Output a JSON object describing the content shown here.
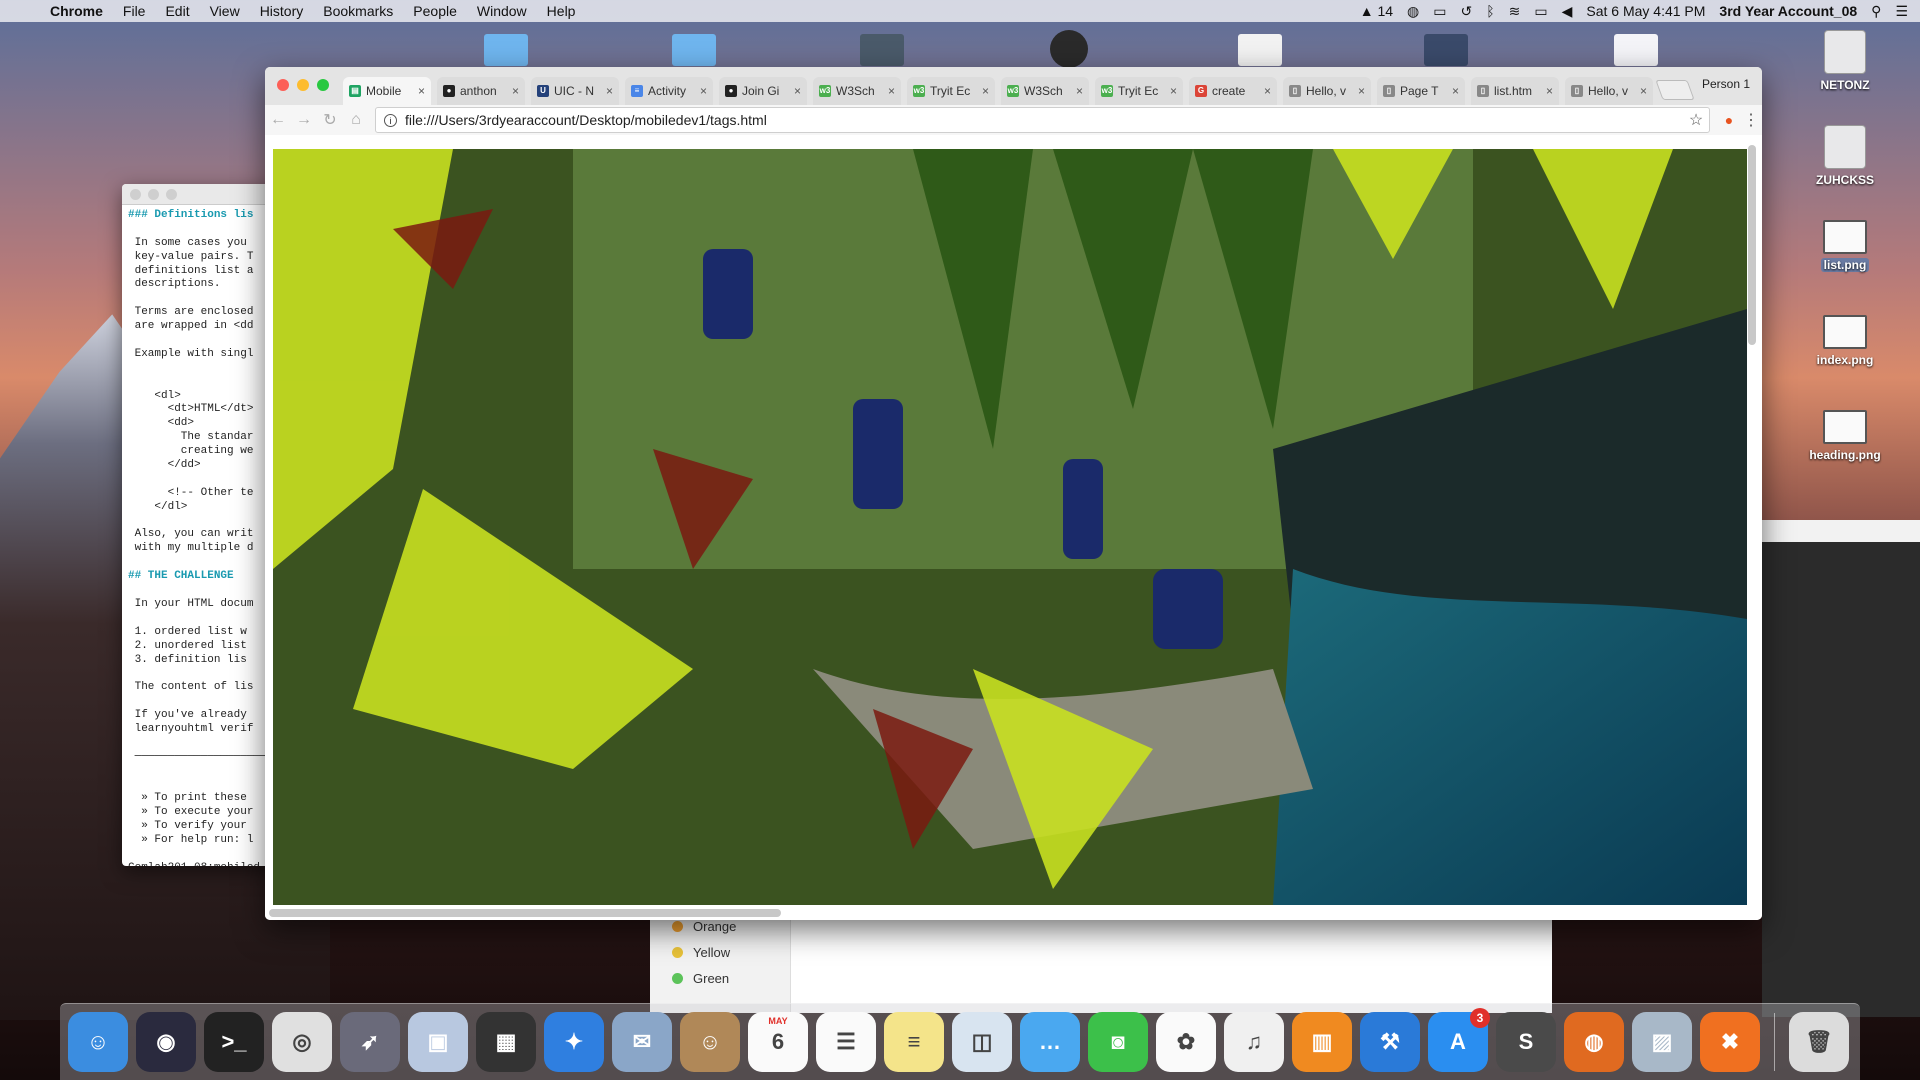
{
  "menubar": {
    "app": "Chrome",
    "items": [
      "File",
      "Edit",
      "View",
      "History",
      "Bookmarks",
      "People",
      "Window",
      "Help"
    ],
    "adobe_count": "14",
    "datetime": "Sat 6 May  4:41 PM",
    "account": "3rd Year Account_08"
  },
  "desktop_icons": [
    {
      "label": "NETONZ",
      "kind": "drive"
    },
    {
      "label": "ZUHCKSS",
      "kind": "drive"
    },
    {
      "label": "list.png",
      "kind": "png",
      "selected": true
    },
    {
      "label": "index.png",
      "kind": "png"
    },
    {
      "label": "heading.png",
      "kind": "png"
    }
  ],
  "terminal": {
    "lines": [
      "### Definitions lis",
      "",
      " In some cases you",
      " key-value pairs. T",
      " definitions list a",
      " descriptions.",
      "",
      " Terms are enclosed",
      " are wrapped in <dd",
      "",
      " Example with singl",
      "",
      "",
      "    <dl>",
      "      <dt>HTML</dt>",
      "      <dd>",
      "        The standar",
      "        creating we",
      "      </dd>",
      "",
      "      <!-- Other te",
      "    </dl>",
      "",
      " Also, you can writ",
      " with my multiple d",
      "",
      "## THE CHALLENGE",
      "",
      " In your HTML docum",
      "",
      " 1. ordered list w",
      " 2. unordered list",
      " 3. definition lis",
      "",
      " The content of lis",
      "",
      " If you've already",
      " learnyouhtml verif",
      "",
      " ─────────────────────",
      "",
      "",
      "  » To print these",
      "  » To execute your",
      "  » To verify your",
      "  » For help run: l",
      "",
      "Comlab201-08:mobiled"
    ]
  },
  "finder_list": [
    {
      "label": "Orange",
      "color": "#f0a030"
    },
    {
      "label": "Yellow",
      "color": "#e8c23a"
    },
    {
      "label": "Green",
      "color": "#5cc35a"
    }
  ],
  "browser": {
    "tabs": [
      {
        "title": "Mobile",
        "fav_color": "#1fa463",
        "fav": "▤",
        "active": true
      },
      {
        "title": "anthon",
        "fav_color": "#222",
        "fav": "●"
      },
      {
        "title": "UIC - N",
        "fav_color": "#24417a",
        "fav": "U"
      },
      {
        "title": "Activity",
        "fav_color": "#4a86e8",
        "fav": "≡"
      },
      {
        "title": "Join Gi",
        "fav_color": "#222",
        "fav": "●"
      },
      {
        "title": "W3Sch",
        "fav_color": "#4caf50",
        "fav": "w3"
      },
      {
        "title": "Tryit Ec",
        "fav_color": "#4caf50",
        "fav": "w3"
      },
      {
        "title": "W3Sch",
        "fav_color": "#4caf50",
        "fav": "w3"
      },
      {
        "title": "Tryit Ec",
        "fav_color": "#4caf50",
        "fav": "w3"
      },
      {
        "title": "create",
        "fav_color": "#db4437",
        "fav": "G"
      },
      {
        "title": "Hello, v",
        "fav_color": "#888",
        "fav": "▯"
      },
      {
        "title": "Page T",
        "fav_color": "#888",
        "fav": "▯"
      },
      {
        "title": "list.htm",
        "fav_color": "#888",
        "fav": "▯"
      },
      {
        "title": "Hello, v",
        "fav_color": "#888",
        "fav": "▯"
      }
    ],
    "profile": "Person 1",
    "url": "file:///Users/3rdyearaccount/Desktop/mobiledev1/tags.html"
  },
  "dock": [
    {
      "name": "Finder",
      "bg": "#3b8de0",
      "glyph": "☺"
    },
    {
      "name": "Siri",
      "bg": "#2a2a3e",
      "glyph": "◉"
    },
    {
      "name": "Terminal",
      "bg": "#222",
      "glyph": ">_"
    },
    {
      "name": "Chrome",
      "bg": "#e0e0e0",
      "glyph": "◎"
    },
    {
      "name": "Launchpad",
      "bg": "#6a6a7a",
      "glyph": "➶"
    },
    {
      "name": "Cube",
      "bg": "#b8c8e0",
      "glyph": "▣"
    },
    {
      "name": "Mission",
      "bg": "#333",
      "glyph": "▦"
    },
    {
      "name": "Safari",
      "bg": "#2f7fe0",
      "glyph": "✦"
    },
    {
      "name": "Mail",
      "bg": "#8aa6c8",
      "glyph": "✉"
    },
    {
      "name": "Contacts",
      "bg": "#b08858",
      "glyph": "☺"
    },
    {
      "name": "Calendar",
      "bg": "#fafafa",
      "glyph": "6",
      "month": "MAY"
    },
    {
      "name": "Reminders",
      "bg": "#fafafa",
      "glyph": "☰"
    },
    {
      "name": "Notes",
      "bg": "#f4e48a",
      "glyph": "≡"
    },
    {
      "name": "Preview",
      "bg": "#d8e4f0",
      "glyph": "◫"
    },
    {
      "name": "Messages",
      "bg": "#4aa8f0",
      "glyph": "…"
    },
    {
      "name": "FaceTime",
      "bg": "#3cc04a",
      "glyph": "◙"
    },
    {
      "name": "Photos",
      "bg": "#fafafa",
      "glyph": "✿"
    },
    {
      "name": "iTunes",
      "bg": "#f0f0f0",
      "glyph": "♫"
    },
    {
      "name": "iBooks",
      "bg": "#f08a20",
      "glyph": "▥"
    },
    {
      "name": "Xcode",
      "bg": "#2a7ad8",
      "glyph": "⚒"
    },
    {
      "name": "App Store",
      "bg": "#2a8ef0",
      "glyph": "A",
      "badge": "3"
    },
    {
      "name": "Sublime Text",
      "bg": "#4a4a4a",
      "glyph": "S"
    },
    {
      "name": "Firefox",
      "bg": "#e06a20",
      "glyph": "◍"
    },
    {
      "name": "Image Capture",
      "bg": "#a8b8c8",
      "glyph": "▨"
    },
    {
      "name": "XAMPP",
      "bg": "#f07020",
      "glyph": "✖"
    },
    {
      "name": "Trash",
      "bg": "#dcdcdc",
      "glyph": "🗑"
    }
  ]
}
